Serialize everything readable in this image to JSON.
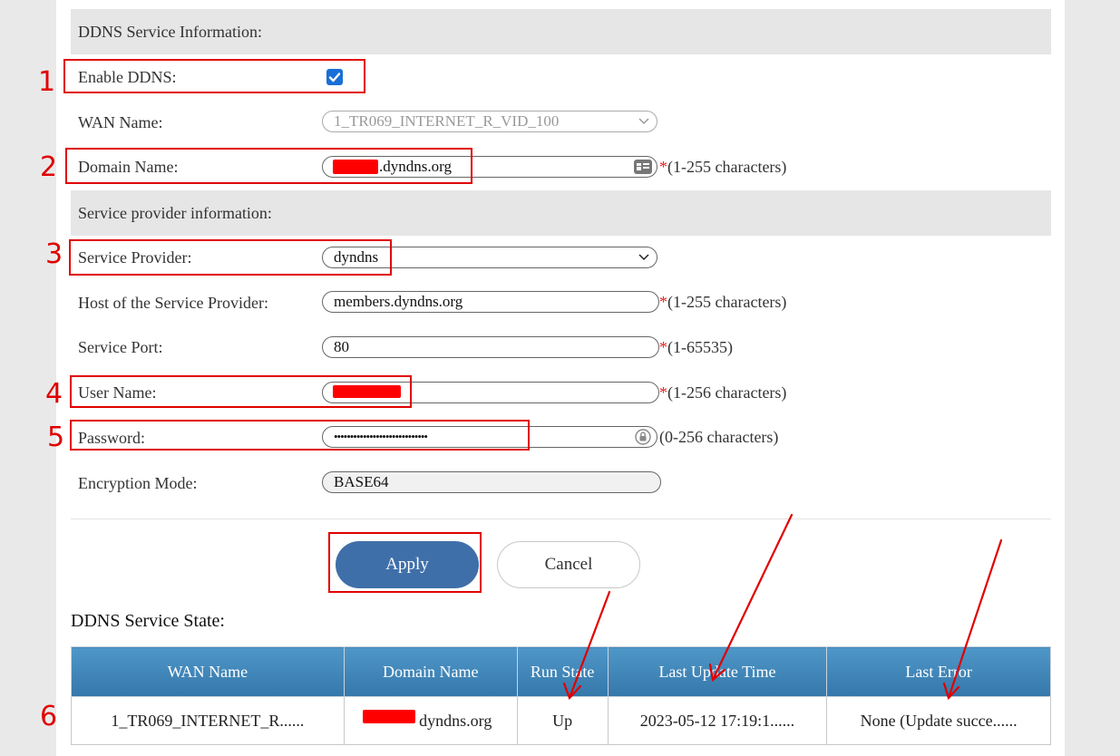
{
  "sections": {
    "ddns_info": "DDNS Service Information:",
    "provider_info": "Service provider information:"
  },
  "form": {
    "enable_ddns": {
      "label": "Enable DDNS:",
      "checked": true
    },
    "wan_name": {
      "label": "WAN Name:",
      "value": "1_TR069_INTERNET_R_VID_100"
    },
    "domain_name": {
      "label": "Domain Name:",
      "value": ".dyndns.org",
      "hint": "(1-255 characters)"
    },
    "service_provider": {
      "label": "Service Provider:",
      "value": "dyndns"
    },
    "host": {
      "label": "Host of the Service Provider:",
      "value": "members.dyndns.org",
      "hint": "(1-255 characters)"
    },
    "port": {
      "label": "Service Port:",
      "value": "80",
      "hint": "(1-65535)"
    },
    "user_name": {
      "label": "User Name:",
      "value": "",
      "hint": "(1-256 characters)"
    },
    "password": {
      "label": "Password:",
      "value": "•••••••••••••••••••••••••••••",
      "hint": "(0-256 characters)"
    },
    "encryption": {
      "label": "Encryption Mode:",
      "value": "BASE64"
    },
    "required_mark": "*"
  },
  "buttons": {
    "apply": "Apply",
    "cancel": "Cancel"
  },
  "state": {
    "title": "DDNS Service State:",
    "headers": [
      "WAN Name",
      "Domain Name",
      "Run State",
      "Last Update Time",
      "Last Error"
    ],
    "row": [
      "1_TR069_INTERNET_R......",
      "dyndns.org",
      "Up",
      "2023-05-12 17:19:1......",
      "None (Update succe......"
    ]
  },
  "annotations": [
    "1",
    "2",
    "3",
    "4",
    "5",
    "6"
  ],
  "colors": {
    "accent": "#3f6fa9",
    "annotation": "#e00000",
    "table_header": "#3f86bb"
  }
}
